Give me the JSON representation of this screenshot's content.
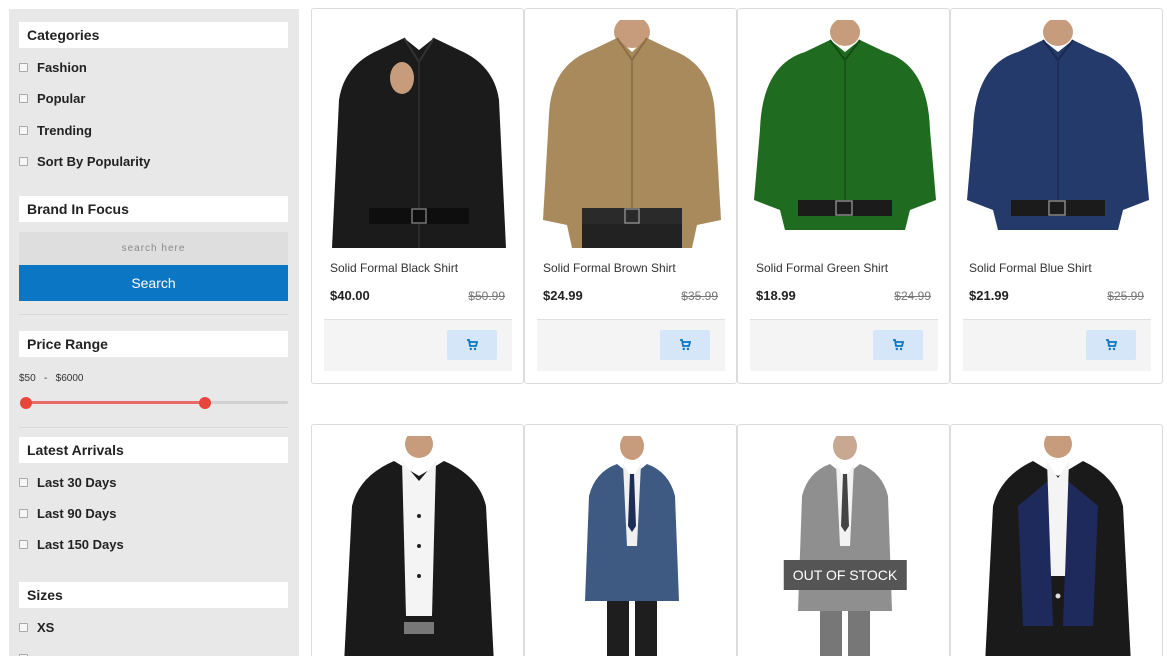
{
  "sidebar": {
    "categories": {
      "title": "Categories",
      "items": [
        "Fashion",
        "Popular",
        "Trending",
        "Sort By Popularity"
      ]
    },
    "brand": {
      "title": "Brand In Focus",
      "search_placeholder": "search here",
      "search_button": "Search"
    },
    "price_range": {
      "title": "Price Range",
      "label": "$50   -   $6000",
      "min": 50,
      "max": 6000
    },
    "latest_arrivals": {
      "title": "Latest Arrivals",
      "items": [
        "Last 30 Days",
        "Last 90 Days",
        "Last 150 Days"
      ]
    },
    "sizes": {
      "title": "Sizes",
      "items": [
        "XS"
      ]
    }
  },
  "products": [
    {
      "name": "Solid Formal Black Shirt",
      "price": "$40.00",
      "old_price": "$50.99",
      "color": "#1b1b1b"
    },
    {
      "name": "Solid Formal Brown Shirt",
      "price": "$24.99",
      "old_price": "$35.99",
      "color": "#a98a5c"
    },
    {
      "name": "Solid Formal Green Shirt",
      "price": "$18.99",
      "old_price": "$24.99",
      "color": "#1f6b1f"
    },
    {
      "name": "Solid Formal Blue Shirt",
      "price": "$21.99",
      "old_price": "$25.99",
      "color": "#243a6b"
    }
  ],
  "products_row2": [
    {
      "item": "black-blazer",
      "color": "#1a1a1a"
    },
    {
      "item": "blue-suit",
      "color": "#3f5a82"
    },
    {
      "item": "grey-suit",
      "color": "#8f8f8f",
      "badge": "OUT OF STOCK"
    },
    {
      "item": "navy-blazer",
      "color": "#1f2a5c"
    }
  ],
  "accent": "#0a76c4"
}
